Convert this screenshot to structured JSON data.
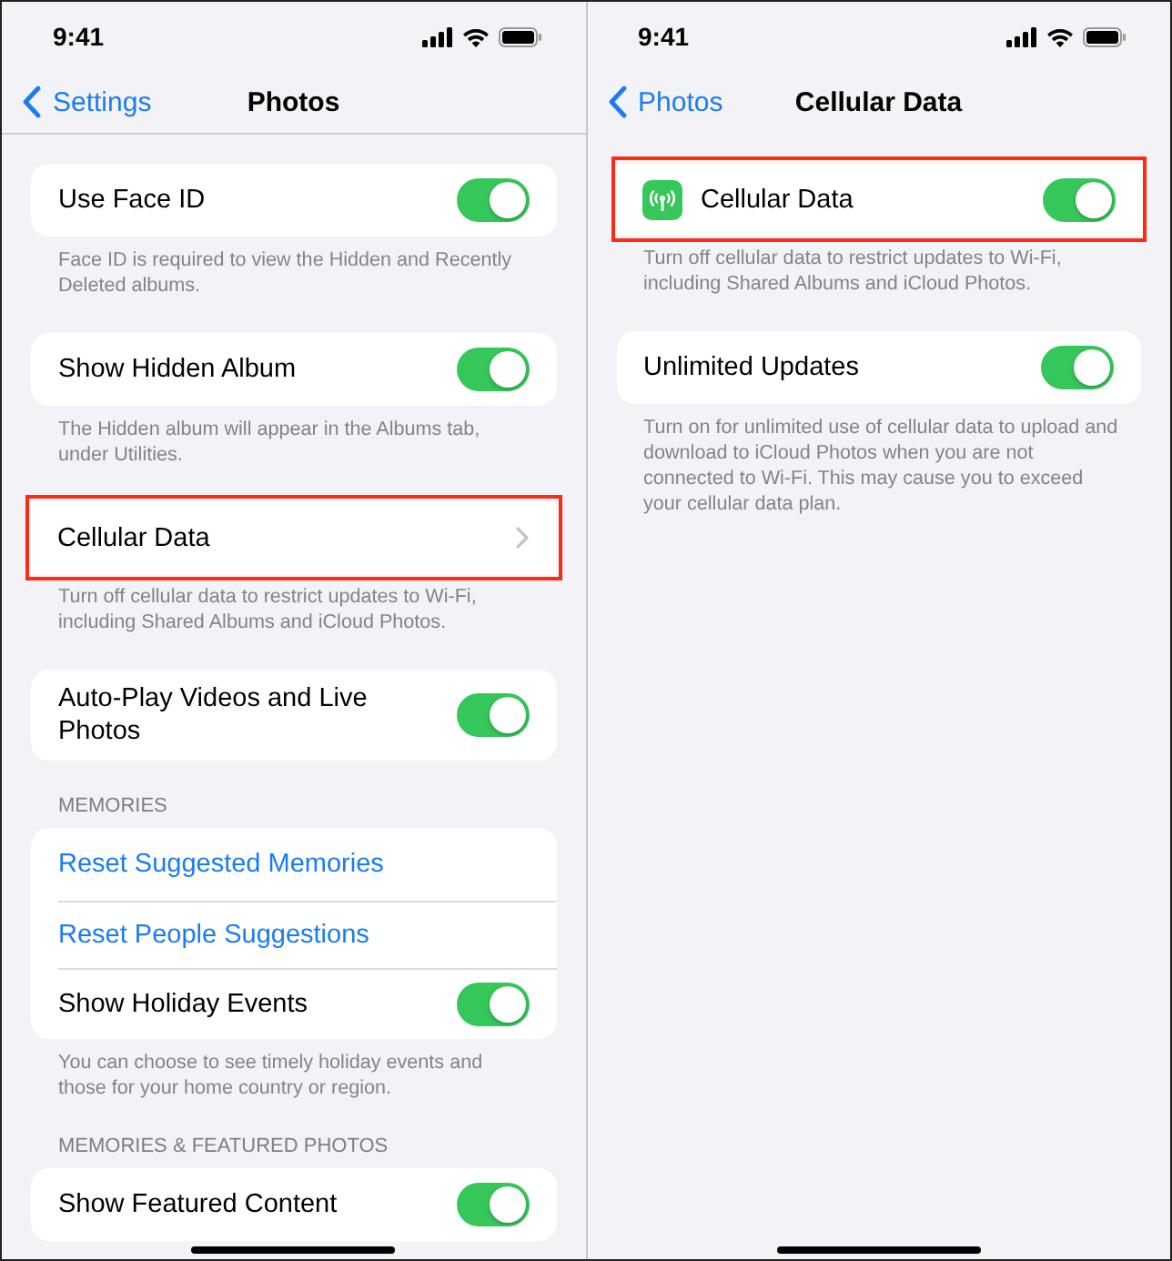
{
  "screens": [
    {
      "status_bar": {
        "time": "9:41"
      },
      "nav": {
        "back": "Settings",
        "title": "Photos",
        "divider": true
      },
      "sections": [
        {
          "highlighted": false,
          "rows": [
            {
              "kind": "toggle",
              "label": "Use Face ID",
              "on": true
            }
          ],
          "footer": "Face ID is required to view the Hidden and Recently Deleted albums."
        },
        {
          "highlighted": false,
          "rows": [
            {
              "kind": "toggle",
              "label": "Show Hidden Album",
              "on": true
            }
          ],
          "footer": "The Hidden album will appear in the Albums tab, under Utilities."
        },
        {
          "highlighted": true,
          "rows": [
            {
              "kind": "chevron",
              "label": "Cellular Data"
            }
          ],
          "footer": "Turn off cellular data to restrict updates to Wi-Fi, including Shared Albums and iCloud Photos."
        },
        {
          "highlighted": false,
          "rows": [
            {
              "kind": "toggle",
              "label": "Auto-Play Videos and Live Photos",
              "on": true
            }
          ]
        },
        {
          "highlighted": false,
          "header": "MEMORIES",
          "rows": [
            {
              "kind": "action",
              "label": "Reset Suggested Memories"
            },
            {
              "kind": "action",
              "label": "Reset People Suggestions"
            },
            {
              "kind": "toggle",
              "label": "Show Holiday Events",
              "on": true
            }
          ],
          "footer": "You can choose to see timely holiday events and those for your home country or region."
        },
        {
          "highlighted": false,
          "header": "MEMORIES & FEATURED PHOTOS",
          "rows": [
            {
              "kind": "toggle",
              "label": "Show Featured Content",
              "on": true
            }
          ]
        }
      ]
    },
    {
      "status_bar": {
        "time": "9:41"
      },
      "nav": {
        "back": "Photos",
        "title": "Cellular Data",
        "divider": false
      },
      "sections": [
        {
          "highlighted": true,
          "rows": [
            {
              "kind": "toggle",
              "label": "Cellular Data",
              "on": true,
              "icon": true
            }
          ],
          "footer": "Turn off cellular data to restrict updates to Wi-Fi, including Shared Albums and iCloud Photos."
        },
        {
          "highlighted": false,
          "rows": [
            {
              "kind": "toggle",
              "label": "Unlimited Updates",
              "on": true
            }
          ],
          "footer": "Turn on for unlimited use of cellular data to upload and download to iCloud Photos when you are not connected to Wi-Fi. This may cause you to exceed your cellular data plan."
        }
      ]
    }
  ]
}
